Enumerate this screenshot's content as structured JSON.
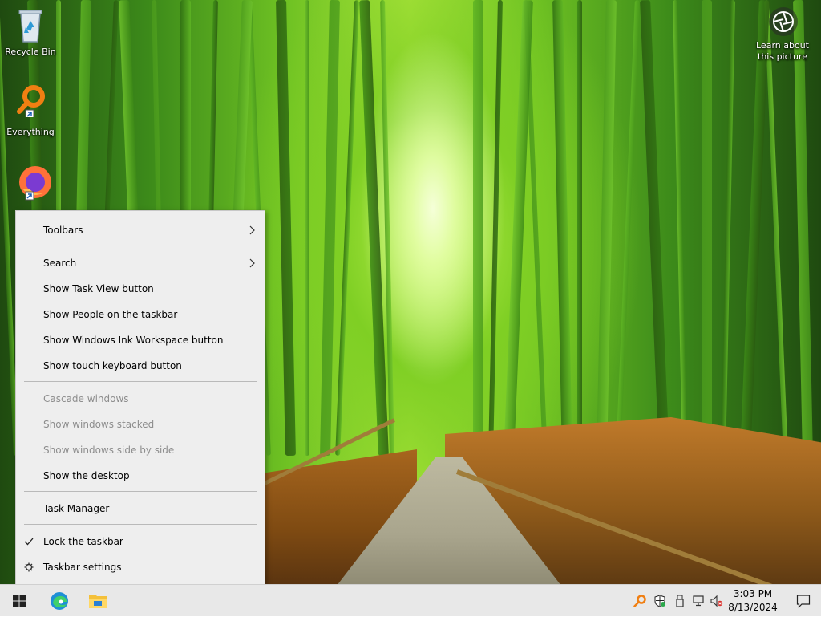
{
  "desktop": {
    "icons": [
      {
        "label": "Recycle Bin"
      },
      {
        "label": "Everything"
      },
      {
        "label": ""
      }
    ],
    "learn_line1": "Learn about",
    "learn_line2": "this picture"
  },
  "context_menu": {
    "toolbars": "Toolbars",
    "search": "Search",
    "show_task_view": "Show Task View button",
    "show_people": "Show People on the taskbar",
    "show_ink": "Show Windows Ink Workspace button",
    "show_touch_keyboard": "Show touch keyboard button",
    "cascade": "Cascade windows",
    "stacked": "Show windows stacked",
    "side_by_side": "Show windows side by side",
    "show_desktop": "Show the desktop",
    "task_manager": "Task Manager",
    "lock_taskbar": "Lock the taskbar",
    "taskbar_settings": "Taskbar settings"
  },
  "taskbar": {
    "time": "3:03 PM",
    "date": "8/13/2024",
    "pinned": [
      "start-icon",
      "edge-icon",
      "file-explorer-icon"
    ],
    "tray": [
      "everything-tray-icon",
      "defender-icon",
      "usb-icon",
      "network-icon",
      "volume-muted-icon"
    ]
  },
  "colors": {
    "menu_bg": "#eeeeee",
    "disabled_text": "#8d8d8d",
    "taskbar_bg": "#e8e8e8"
  }
}
